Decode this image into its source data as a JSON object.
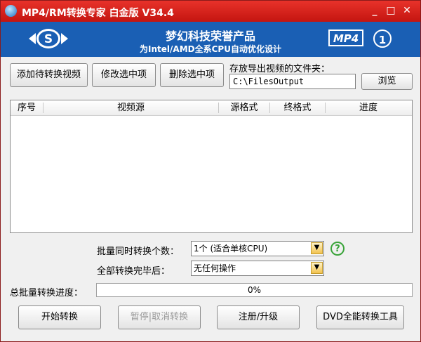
{
  "window": {
    "title": "MP4/RM转换专家 白金版 V34.4",
    "minimize": "_",
    "maximize": "□",
    "close": "✕"
  },
  "banner": {
    "logo_letter": "S",
    "title": "梦幻科技荣誉产品",
    "subtitle": "为Intel/AMD全系CPU自动优化设计",
    "badge_text": "MP4",
    "badge_number": "1"
  },
  "toolbar": {
    "add_label": "添加待转换视频",
    "modify_label": "修改选中项",
    "delete_label": "删除选中项",
    "output_folder_label": "存放导出视频的文件夹：",
    "output_folder_value": "C:\\FilesOutput",
    "browse_label": "浏览"
  },
  "list": {
    "columns": [
      "序号",
      "视频源",
      "源格式",
      "终格式",
      "进度"
    ]
  },
  "options": {
    "concurrent_label": "批量同时转换个数：",
    "concurrent_value": "1个  (适合单核CPU)",
    "after_label": "全部转换完毕后：",
    "after_value": "无任何操作",
    "help": "?"
  },
  "progress": {
    "label": "总批量转换进度：",
    "text": "0%",
    "value": 0
  },
  "actions": {
    "start": "开始转换",
    "pause": "暂停|取消转换",
    "register": "注册/升级",
    "dvd": "DVD全能转换工具"
  }
}
